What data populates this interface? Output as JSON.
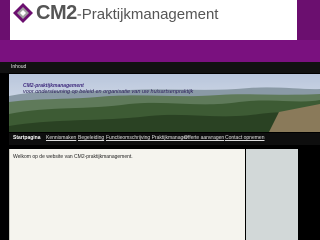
{
  "header": {
    "logo_main": "CM2",
    "logo_rest": "-Praktijkmanagement"
  },
  "topbar": {
    "inhoud_label": "Inhoud"
  },
  "banner": {
    "tagline_line1": "CM2-praktijkmanagement",
    "tagline_line2": "voor ondersteuning op beleid en organisatie van uw huisartsenpraktijk"
  },
  "nav": {
    "items": [
      {
        "label": "Startpagina",
        "active": true
      },
      {
        "label": "Kennismaken",
        "active": false
      },
      {
        "label": "Begeleiding",
        "active": false
      },
      {
        "label": "Functieomschrijving Praktijkmanager",
        "active": false
      },
      {
        "label": "Offerte aanvragen",
        "active": false
      },
      {
        "label": "Contact opnemen",
        "active": false
      }
    ]
  },
  "content": {
    "welcome_text": "Welkom op de website van CM2-praktijkmanagement."
  },
  "colors": {
    "brand_purple": "#6b0f6f",
    "sidebar": "#d2d8d8",
    "content_bg": "#f5f4ee"
  }
}
